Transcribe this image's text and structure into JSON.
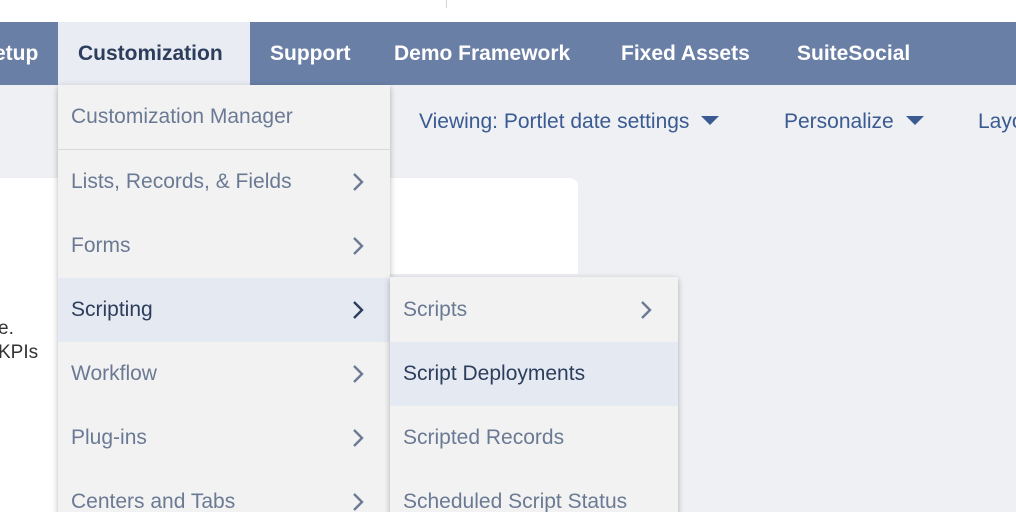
{
  "nav": {
    "items": [
      {
        "label": "etup"
      },
      {
        "label": "Customization"
      },
      {
        "label": "Support"
      },
      {
        "label": "Demo Framework"
      },
      {
        "label": "Fixed Assets"
      },
      {
        "label": "SuiteSocial"
      }
    ]
  },
  "subbar": {
    "viewing": "Viewing: Portlet date settings",
    "personalize": "Personalize",
    "layout": "Layo"
  },
  "background": {
    "line1": "e.",
    "line2": "KPIs"
  },
  "customization_menu": {
    "manager": "Customization Manager",
    "items": [
      {
        "label": "Lists, Records, & Fields"
      },
      {
        "label": "Forms"
      },
      {
        "label": "Scripting"
      },
      {
        "label": "Workflow"
      },
      {
        "label": "Plug-ins"
      },
      {
        "label": "Centers and Tabs"
      }
    ]
  },
  "scripting_menu": {
    "items": [
      {
        "label": "Scripts"
      },
      {
        "label": "Script Deployments"
      },
      {
        "label": "Scripted Records"
      },
      {
        "label": "Scheduled Script Status"
      }
    ]
  },
  "colors": {
    "navbar": "#6a7fa6",
    "active_menu_bg": "#e5e9f2",
    "link": "#3a5a92"
  }
}
